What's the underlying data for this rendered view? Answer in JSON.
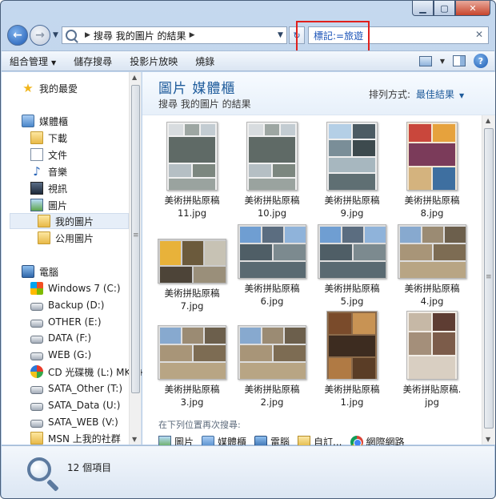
{
  "address": {
    "breadcrumb": "搜尋 我的圖片 的結果",
    "search_query": "標記:=旅遊"
  },
  "toolbar": {
    "organize": "組合管理",
    "save_search": "儲存搜尋",
    "slideshow": "投影片放映",
    "burn": "燒錄"
  },
  "nav": {
    "favorites": "我的最愛",
    "libraries": "媒體櫃",
    "downloads": "下載",
    "documents": "文件",
    "music": "音樂",
    "videos": "視訊",
    "pictures": "圖片",
    "my_pictures": "我的圖片",
    "public_pictures": "公用圖片",
    "computer": "電腦",
    "drives": [
      {
        "label": "Windows 7 (C:)",
        "icon": "windows-drive-icon"
      },
      {
        "label": "Backup (D:)",
        "icon": "drive-icon"
      },
      {
        "label": "OTHER (E:)",
        "icon": "drive-icon"
      },
      {
        "label": "DATA (F:)",
        "icon": "drive-icon"
      },
      {
        "label": "WEB (G:)",
        "icon": "drive-icon"
      },
      {
        "label": "CD 光碟機 (L:) MKS+",
        "icon": "cd-drive-icon"
      },
      {
        "label": "SATA_Other (T:)",
        "icon": "drive-icon"
      },
      {
        "label": "SATA_Data (U:)",
        "icon": "drive-icon"
      },
      {
        "label": "SATA_WEB (V:)",
        "icon": "drive-icon"
      },
      {
        "label": "MSN 上我的社群",
        "icon": "folder-icon"
      }
    ]
  },
  "content": {
    "library_title": "圖片 媒體櫃",
    "library_subtitle": "搜尋 我的圖片 的結果",
    "sort_label": "排列方式:",
    "sort_value": "最佳結果",
    "files": [
      {
        "line1": "美術拼貼原稿",
        "line2": "11.jpg"
      },
      {
        "line1": "美術拼貼原稿",
        "line2": "10.jpg"
      },
      {
        "line1": "美術拼貼原稿",
        "line2": "9.jpg"
      },
      {
        "line1": "美術拼貼原稿",
        "line2": "8.jpg"
      },
      {
        "line1": "美術拼貼原稿",
        "line2": "7.jpg"
      },
      {
        "line1": "美術拼貼原稿",
        "line2": "6.jpg"
      },
      {
        "line1": "美術拼貼原稿",
        "line2": "5.jpg"
      },
      {
        "line1": "美術拼貼原稿",
        "line2": "4.jpg"
      },
      {
        "line1": "美術拼貼原稿",
        "line2": "3.jpg"
      },
      {
        "line1": "美術拼貼原稿",
        "line2": "2.jpg"
      },
      {
        "line1": "美術拼貼原稿",
        "line2": "1.jpg"
      },
      {
        "line1": "美術拼貼原稿.",
        "line2": "jpg"
      }
    ],
    "search_again_label": "在下列位置再次搜尋:",
    "search_again": {
      "pictures": "圖片",
      "libraries": "媒體櫃",
      "computer": "電腦",
      "custom": "自訂...",
      "internet": "網際網路"
    }
  },
  "details": {
    "item_count": "12 個項目"
  },
  "colors": {
    "accent_blue": "#1e5b9b",
    "highlight_red": "#e0201c"
  }
}
